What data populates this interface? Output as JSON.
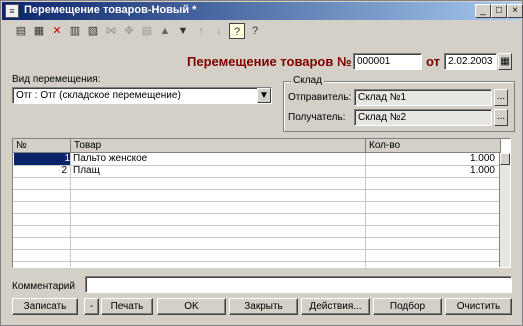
{
  "window": {
    "title": "Перемещение товаров-Новый *",
    "app_icon": "doc-icon",
    "controls": [
      "_",
      "□",
      "×"
    ]
  },
  "toolbar": {
    "icons": [
      "new-doc-icon",
      "copy-doc-icon",
      "delete-doc-icon",
      "copy-row-icon",
      "insert-row-icon",
      "cut-icon",
      "move-icon",
      "edit-row-icon",
      "arrow-up-icon",
      "arrow-down-icon",
      "sort-asc-icon",
      "sort-desc-icon",
      "help-icon",
      "context-help-icon"
    ],
    "glyphs": [
      "▤",
      "▦",
      "✕",
      "▥",
      "▧",
      "⋈",
      "✥",
      "▤",
      "▲",
      "▼",
      "↑",
      "↓",
      "?",
      "?"
    ]
  },
  "header": {
    "doc_label": "Перемещение товаров №",
    "doc_number": "000001",
    "date_label": "от",
    "date_value": "2.02.2003"
  },
  "movement": {
    "label": "Вид перемещения:",
    "value": "Отг : Отг (складское перемещение)"
  },
  "warehouse": {
    "group_label": "Склад",
    "sender_label": "Отправитель:",
    "sender_value": "Склад №1",
    "receiver_label": "Получатель:",
    "receiver_value": "Склад №2"
  },
  "table": {
    "columns": [
      "№",
      "Товар",
      "Кол-во"
    ],
    "rows": [
      {
        "num": "1",
        "item": "Пальто женское",
        "qty": "1.000"
      },
      {
        "num": "2",
        "item": "Плащ",
        "qty": "1.000"
      }
    ]
  },
  "comment": {
    "label": "Комментарий",
    "value": ""
  },
  "buttons": {
    "record": "Записать",
    "dash": "-",
    "print": "Печать",
    "ok": "OK",
    "close": "Закрыть",
    "actions": "Действия...",
    "select": "Подбор",
    "fill": "Очистить"
  }
}
